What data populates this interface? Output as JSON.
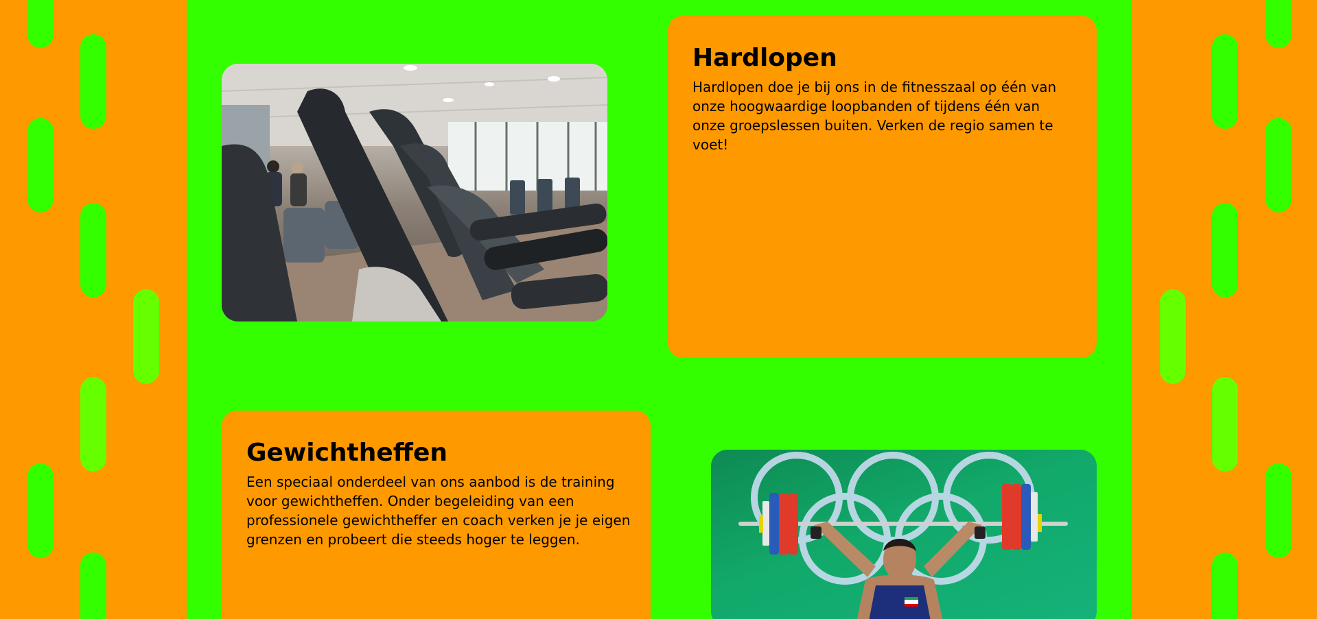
{
  "sections": [
    {
      "title": "Hardlopen",
      "text": "Hardlopen doe je bij ons in de fitnesszaal op één van onze hoogwaardige loopbanden of tijdens één van onze groepslessen buiten. Verken de regio samen te voet!",
      "image": "gym-treadmills-photo"
    },
    {
      "title": "Gewichtheffen",
      "text": "Een speciaal onderdeel van ons aanbod is de training voor gewichtheffen. Onder begeleiding van een professionele gewichtheffer en coach verken je je eigen grenzen en probeert die steeds hoger te leggen.",
      "image": "weightlifter-photo"
    }
  ],
  "colors": {
    "background": "#33ff00",
    "card": "#ff9900",
    "pill": "#33ff00",
    "pill_light": "#66ff00"
  }
}
